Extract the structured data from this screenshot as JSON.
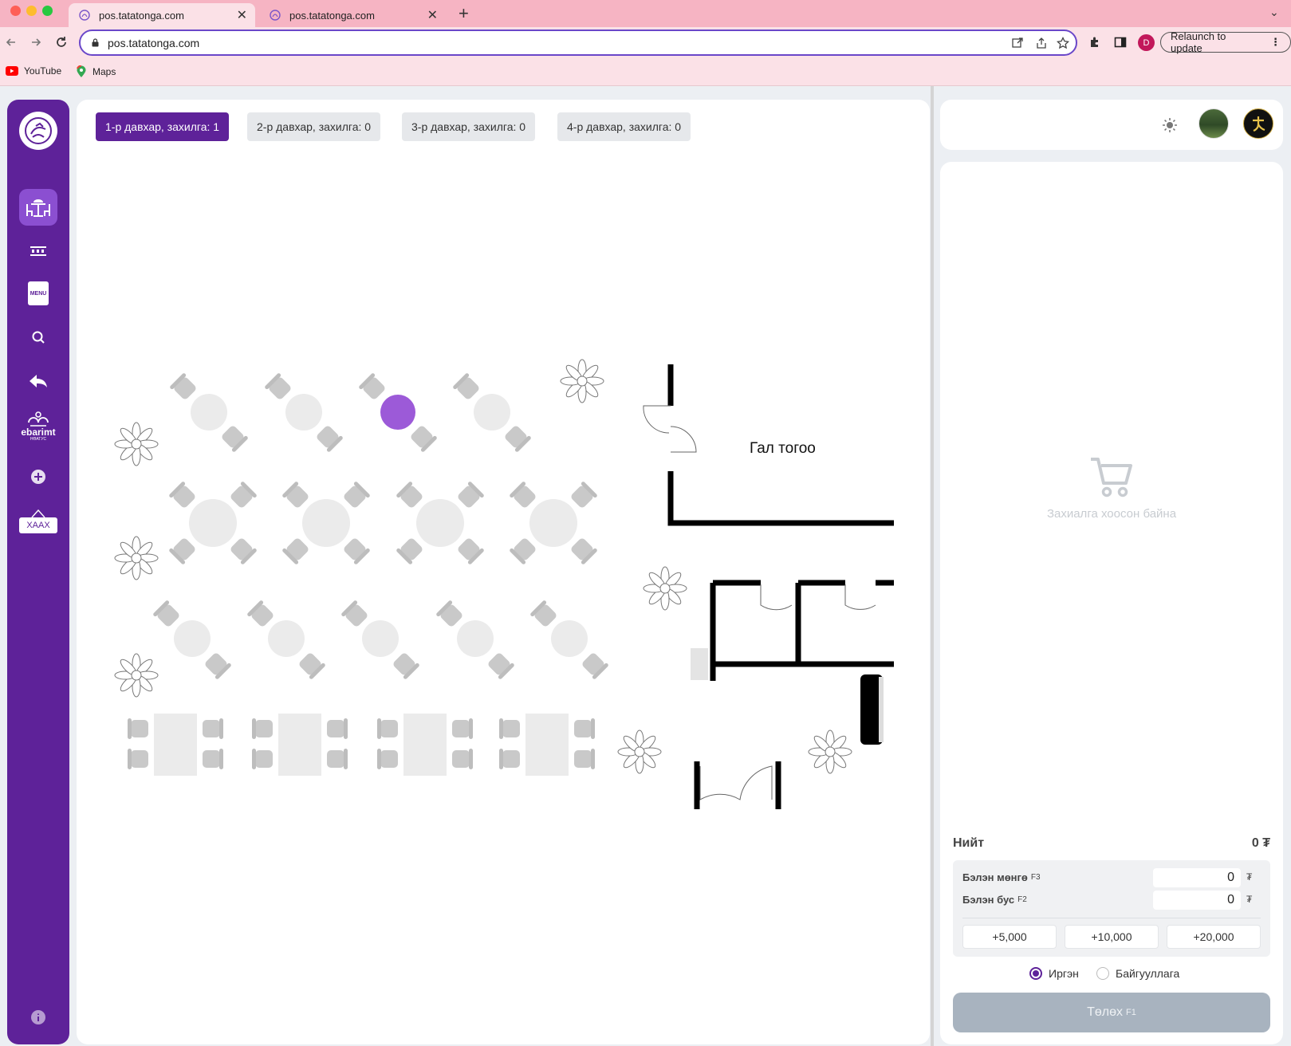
{
  "browser": {
    "tabs": [
      {
        "title": "pos.tatatonga.com",
        "active": true
      },
      {
        "title": "pos.tatatonga.com",
        "active": false
      }
    ],
    "url": "pos.tatatonga.com",
    "profile_initial": "D",
    "relaunch_label": "Relaunch to update",
    "bookmarks": [
      {
        "label": "YouTube",
        "icon": "youtube-icon"
      },
      {
        "label": "Maps",
        "icon": "maps-icon"
      }
    ]
  },
  "sidebar": {
    "items": [
      {
        "name": "tables",
        "icon": "dining-table-icon",
        "active": true
      },
      {
        "name": "orders",
        "icon": "order-list-icon"
      },
      {
        "name": "menu",
        "icon": "menu-book-icon",
        "label": "MENU"
      },
      {
        "name": "search",
        "icon": "search-icon"
      },
      {
        "name": "return",
        "icon": "reply-icon"
      },
      {
        "name": "ebarimt",
        "icon": "ebarimt-icon",
        "label": "ebarimt",
        "sublabel": "НӨАТУС"
      },
      {
        "name": "add",
        "icon": "plus-icon"
      },
      {
        "name": "close-shift",
        "icon": "closed-sign-icon",
        "label": "ХААХ"
      }
    ],
    "info_icon": "info-icon"
  },
  "floors": [
    {
      "label": "1-р давхар, захилга: 1",
      "active": true
    },
    {
      "label": "2-р давхар, захилга: 0",
      "active": false
    },
    {
      "label": "3-р давхар, захилга: 0",
      "active": false
    },
    {
      "label": "4-р давхар, захилга: 0",
      "active": false
    }
  ],
  "floor_plan": {
    "kitchen_label": "Гал тогоо",
    "colors": {
      "occupied": "#9c5ad8",
      "free": "#ebebeb",
      "chair": "#c9c9c9",
      "wall": "#000000"
    }
  },
  "topbar": {
    "theme_icon": "sun-icon",
    "avatar_icon": "user-avatar",
    "brand_icon": "brand-logo-icon"
  },
  "order": {
    "empty_text": "Захиалга хоосон байна",
    "total_label": "Нийт",
    "total_value": "0 ₮",
    "cash_label": "Бэлэн мөнгө",
    "cash_hotkey": "F3",
    "cash_value": "0",
    "noncash_label": "Бэлэн бус",
    "noncash_hotkey": "F2",
    "noncash_value": "0",
    "currency": "₮",
    "quick_amounts": [
      "+5,000",
      "+10,000",
      "+20,000"
    ],
    "customer_types": [
      {
        "label": "Иргэн",
        "selected": true
      },
      {
        "label": "Байгууллага",
        "selected": false
      }
    ],
    "pay_label": "Төлөх",
    "pay_hotkey": "F1"
  }
}
